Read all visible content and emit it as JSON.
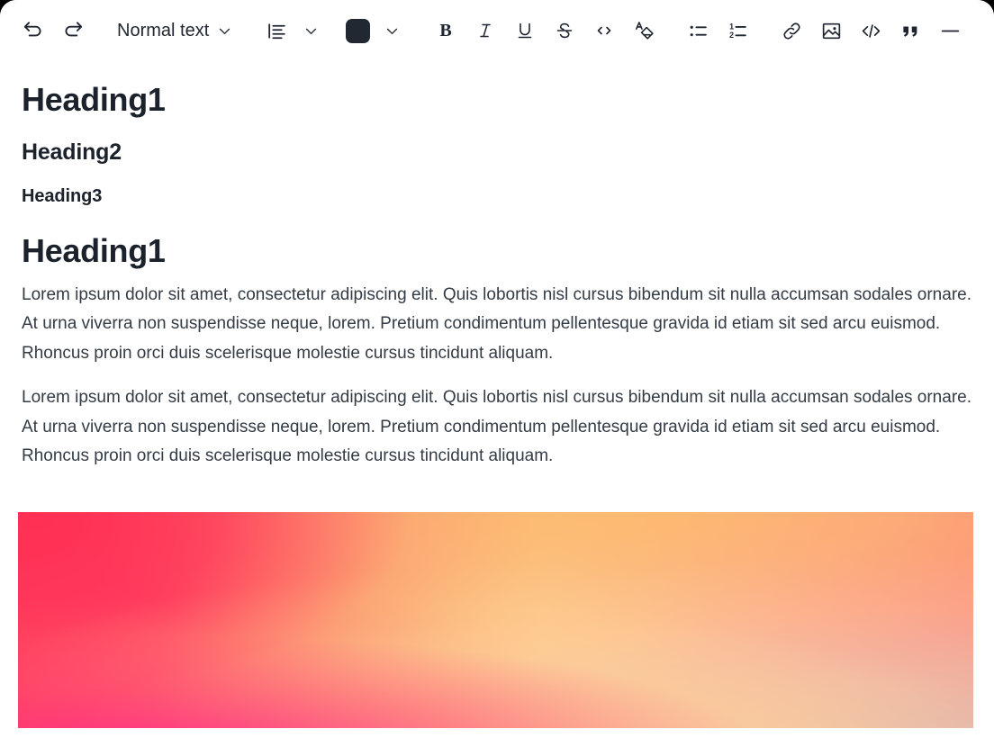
{
  "toolbar": {
    "undo": {
      "label": "Undo",
      "icon": "undo-icon"
    },
    "redo": {
      "label": "Redo",
      "icon": "redo-icon"
    },
    "text_style": {
      "selected": "Normal text",
      "options": [
        "Normal text",
        "Heading1",
        "Heading2",
        "Heading3"
      ],
      "icon": "chevron-down-icon"
    },
    "align": {
      "label": "Align left",
      "icon": "align-left-icon",
      "chevron": "chevron-down-icon"
    },
    "text_color": {
      "label": "Text color",
      "value": "#212832",
      "icon": "color-swatch-icon",
      "chevron": "chevron-down-icon"
    },
    "bold": {
      "label": "B",
      "icon": "bold-icon"
    },
    "italic": {
      "label": "I",
      "icon": "italic-icon"
    },
    "underline": {
      "label": "U",
      "icon": "underline-icon"
    },
    "strikethrough": {
      "label": "S",
      "icon": "strikethrough-icon"
    },
    "inline_code": {
      "label": "< >",
      "icon": "inline-code-icon"
    },
    "clear_format": {
      "label": "Clear formatting",
      "icon": "clear-formatting-icon"
    },
    "bullet_list": {
      "label": "Bulleted list",
      "icon": "bullet-list-icon"
    },
    "numbered_list": {
      "label": "Numbered list",
      "icon": "numbered-list-icon"
    },
    "link": {
      "label": "Insert link",
      "icon": "link-icon"
    },
    "image": {
      "label": "Insert image",
      "icon": "image-icon"
    },
    "code_block": {
      "label": "Code block",
      "icon": "code-block-icon"
    },
    "quote": {
      "label": "Blockquote",
      "icon": "quote-icon"
    },
    "divider": {
      "label": "Horizontal rule",
      "icon": "horizontal-rule-icon"
    }
  },
  "document": {
    "heading1_sample": "Heading1",
    "heading2_sample": "Heading2",
    "heading3_sample": "Heading3",
    "section_heading": "Heading1",
    "paragraph_1": "Lorem ipsum dolor sit amet, consectetur adipiscing elit. Quis lobortis nisl cursus bibendum sit nulla accumsan sodales ornare. At urna viverra non suspendisse neque, lorem. Pretium condimentum pellentesque gravida id etiam sit sed arcu euismod. Rhoncus proin orci duis scelerisque molestie cursus tincidunt aliquam.",
    "paragraph_2": "Lorem ipsum dolor sit amet, consectetur adipiscing elit. Quis lobortis nisl cursus bibendum sit nulla accumsan sodales ornare. At urna viverra non suspendisse neque, lorem. Pretium condimentum pellentesque gravida id etiam sit sed arcu euismod. Rhoncus proin orci duis scelerisque molestie cursus tincidunt aliquam.",
    "image_alt": "Pink to orange gradient image"
  },
  "colors": {
    "text_dark": "#1b222c",
    "body_text": "#333b45",
    "toolbar_icon": "#1e2430",
    "swatch": "#212832",
    "gradient_pink": "#ff2f56",
    "gradient_orange": "#fcbe7e",
    "gradient_yellow": "#fdd392",
    "gradient_peach": "#f79086"
  }
}
